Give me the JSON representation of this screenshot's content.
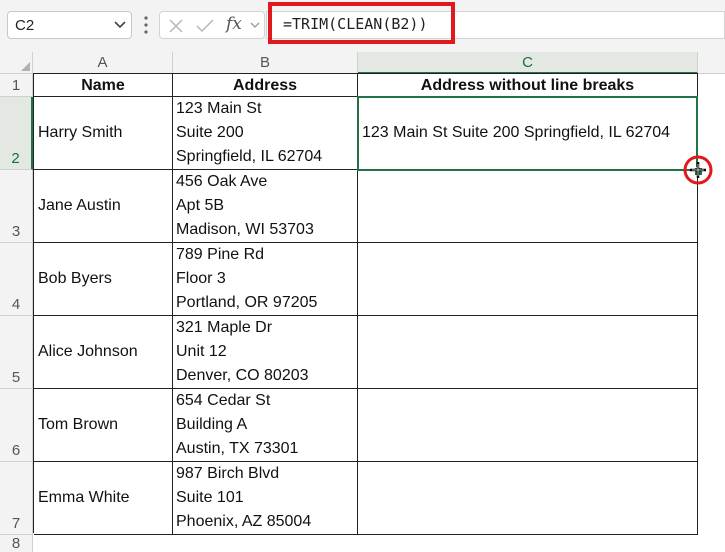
{
  "name_box": {
    "value": "C2"
  },
  "formula_bar": {
    "fx_label": "fx",
    "formula": "=TRIM(CLEAN(B2))"
  },
  "columns": [
    "A",
    "B",
    "C"
  ],
  "rows": [
    "1",
    "2",
    "3",
    "4",
    "5",
    "6",
    "7",
    "8"
  ],
  "header_row": {
    "name": "Name",
    "address": "Address",
    "result": "Address without line breaks"
  },
  "data_rows": [
    {
      "name": "Harry Smith",
      "address": [
        "123 Main St",
        "Suite 200",
        "Springfield, IL 62704"
      ],
      "result": "123 Main St Suite 200 Springfield, IL 62704"
    },
    {
      "name": "Jane Austin",
      "address": [
        "456 Oak Ave",
        "Apt 5B",
        "Madison, WI 53703"
      ],
      "result": ""
    },
    {
      "name": "Bob Byers",
      "address": [
        "789 Pine Rd",
        "Floor 3",
        "Portland, OR 97205"
      ],
      "result": ""
    },
    {
      "name": "Alice Johnson",
      "address": [
        "321 Maple Dr",
        "Unit 12",
        "Denver, CO 80203"
      ],
      "result": ""
    },
    {
      "name": "Tom Brown",
      "address": [
        "654 Cedar St",
        "Building A",
        "Austin, TX 73301"
      ],
      "result": ""
    },
    {
      "name": "Emma White",
      "address": [
        "987 Birch Blvd",
        "Suite 101",
        "Phoenix, AZ 85004"
      ],
      "result": ""
    }
  ],
  "colors": {
    "accent": "#217346",
    "highlight": "#e0191e"
  }
}
